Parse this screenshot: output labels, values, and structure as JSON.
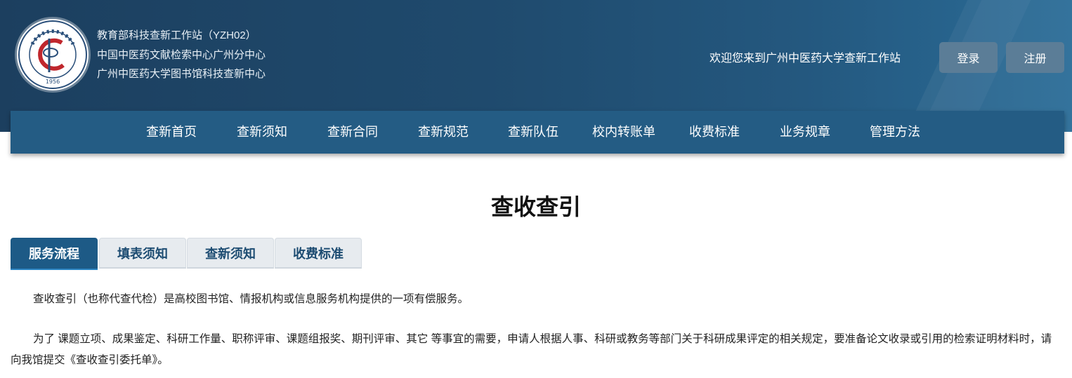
{
  "header": {
    "org_lines": [
      "教育部科技查新工作站（YZH02）",
      "中国中医药文献检索中心广州分中心",
      "广州中医药大学图书馆科技查新中心"
    ],
    "logo": {
      "icon": "university-seal-icon",
      "year": "1956"
    },
    "welcome": "欢迎您来到广州中医药大学查新工作站",
    "login_label": "登录",
    "register_label": "注册"
  },
  "nav": {
    "items": [
      {
        "label": "查新首页"
      },
      {
        "label": "查新须知"
      },
      {
        "label": "查新合同"
      },
      {
        "label": "查新规范"
      },
      {
        "label": "查新队伍"
      },
      {
        "label": "校内转账单"
      },
      {
        "label": "收费标准"
      },
      {
        "label": "业务规章"
      },
      {
        "label": "管理方法"
      }
    ]
  },
  "page": {
    "title": "查收查引",
    "tabs": [
      {
        "label": "服务流程",
        "active": true
      },
      {
        "label": "填表须知",
        "active": false
      },
      {
        "label": "查新须知",
        "active": false
      },
      {
        "label": "收费标准",
        "active": false
      }
    ],
    "paragraphs": [
      "查收查引（也称代查代检）是高校图书馆、情报机构或信息服务机构提供的一项有偿服务。",
      "为了 课题立项、成果鉴定、科研工作量、职称评审、课题组报奖、期刊评审、其它 等事宜的需要，申请人根据人事、科研或教务等部门关于科研成果评定的相关规定，要准备论文收录或引用的检索证明材料时，请向我馆提交《查收查引委托单》。"
    ]
  },
  "colors": {
    "header_bg": "#1f4a6d",
    "nav_bg": "#245c84",
    "active_tab": "#1d5a86",
    "header_button": "#5b7d97"
  }
}
